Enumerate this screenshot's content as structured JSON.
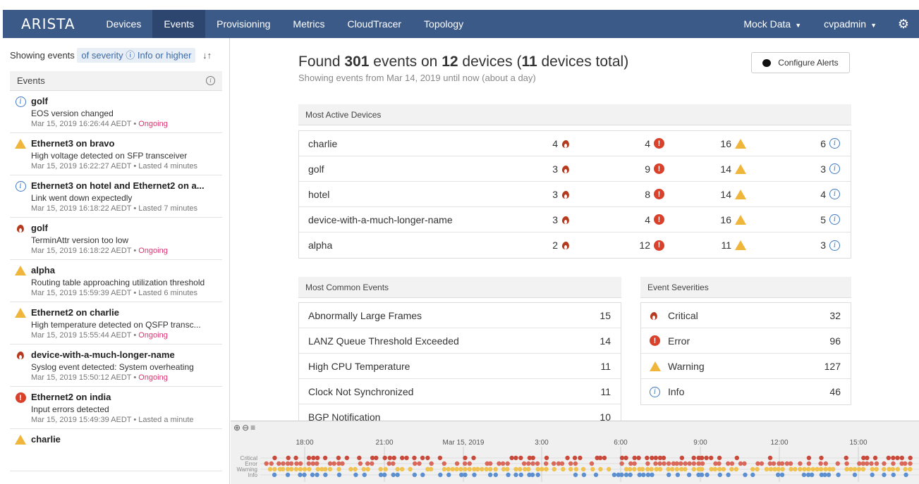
{
  "nav": {
    "brand": "ARISTA",
    "items": [
      "Devices",
      "Events",
      "Provisioning",
      "Metrics",
      "CloudTracer",
      "Topology"
    ],
    "active": "Events",
    "mock_data": "Mock Data",
    "user": "cvpadmin"
  },
  "sidebar": {
    "filter_prefix": "Showing events",
    "filter_chip": "of severity ⓘ Info or higher",
    "events_header": "Events",
    "events": [
      {
        "severity": "info",
        "title": "golf",
        "desc": "EOS version changed",
        "time": "Mar 15, 2019 16:26:44 AEDT",
        "status": "Ongoing",
        "ongoing": true
      },
      {
        "severity": "warning",
        "title": "Ethernet3 on bravo",
        "desc": "High voltage detected on SFP transceiver",
        "time": "Mar 15, 2019 16:22:27 AEDT",
        "status": "Lasted 4 minutes",
        "ongoing": false
      },
      {
        "severity": "info",
        "title": "Ethernet3 on hotel and Ethernet2 on a...",
        "desc": "Link went down expectedly",
        "time": "Mar 15, 2019 16:18:22 AEDT",
        "status": "Lasted 7 minutes",
        "ongoing": false
      },
      {
        "severity": "critical",
        "title": "golf",
        "desc": "TerminAttr version too low",
        "time": "Mar 15, 2019 16:18:22 AEDT",
        "status": "Ongoing",
        "ongoing": true
      },
      {
        "severity": "warning",
        "title": "alpha",
        "desc": "Routing table approaching utilization threshold",
        "time": "Mar 15, 2019 15:59:39 AEDT",
        "status": "Lasted 6 minutes",
        "ongoing": false
      },
      {
        "severity": "warning",
        "title": "Ethernet2 on charlie",
        "desc": "High temperature detected on QSFP transc...",
        "time": "Mar 15, 2019 15:55:44 AEDT",
        "status": "Ongoing",
        "ongoing": true
      },
      {
        "severity": "critical",
        "title": "device-with-a-much-longer-name",
        "desc": "Syslog event detected: System overheating",
        "time": "Mar 15, 2019 15:50:12 AEDT",
        "status": "Ongoing",
        "ongoing": true
      },
      {
        "severity": "error",
        "title": "Ethernet2 on india",
        "desc": "Input errors detected",
        "time": "Mar 15, 2019 15:49:39 AEDT",
        "status": "Lasted a minute",
        "ongoing": false
      },
      {
        "severity": "warning",
        "title": "charlie",
        "desc": "",
        "time": "",
        "status": "",
        "ongoing": false
      }
    ]
  },
  "summary": {
    "found_prefix": "Found",
    "events_count": "301",
    "events_on": "events on",
    "devices_count": "12",
    "devices_word": "devices (",
    "total_count": "11",
    "total_suffix": "devices total)",
    "subtitle": "Showing events from Mar 14, 2019 until now (about a day)",
    "configure_alerts": "Configure Alerts"
  },
  "most_active": {
    "header": "Most Active Devices",
    "rows": [
      {
        "device": "charlie",
        "critical": "4",
        "error": "4",
        "warning": "16",
        "info": "6"
      },
      {
        "device": "golf",
        "critical": "3",
        "error": "9",
        "warning": "14",
        "info": "3"
      },
      {
        "device": "hotel",
        "critical": "3",
        "error": "8",
        "warning": "14",
        "info": "4"
      },
      {
        "device": "device-with-a-much-longer-name",
        "critical": "3",
        "error": "4",
        "warning": "16",
        "info": "5"
      },
      {
        "device": "alpha",
        "critical": "2",
        "error": "12",
        "warning": "11",
        "info": "3"
      }
    ]
  },
  "common_events": {
    "header": "Most Common Events",
    "rows": [
      {
        "name": "Abnormally Large Frames",
        "count": "15"
      },
      {
        "name": "LANZ Queue Threshold Exceeded",
        "count": "14"
      },
      {
        "name": "High CPU Temperature",
        "count": "11"
      },
      {
        "name": "Clock Not Synchronized",
        "count": "11"
      },
      {
        "name": "BGP Notification",
        "count": "10"
      }
    ]
  },
  "severities": {
    "header": "Event Severities",
    "rows": [
      {
        "key": "critical",
        "label": "Critical",
        "count": "32"
      },
      {
        "key": "error",
        "label": "Error",
        "count": "96"
      },
      {
        "key": "warning",
        "label": "Warning",
        "count": "127"
      },
      {
        "key": "info",
        "label": "Info",
        "count": "46"
      }
    ]
  },
  "timeline": {
    "tick_labels": [
      "18:00",
      "21:00",
      "Mar 15, 2019",
      "3:00",
      "6:00",
      "9:00",
      "12:00",
      "15:00"
    ],
    "lane_labels": [
      "Critical",
      "Error",
      "Warning",
      "Info"
    ]
  },
  "colors": {
    "nav": "#3c5a87",
    "critical": "#b63a1d",
    "error": "#d9412b",
    "warning": "#f0b53b",
    "info": "#3e78c6",
    "ongoing": "#e0316f"
  }
}
